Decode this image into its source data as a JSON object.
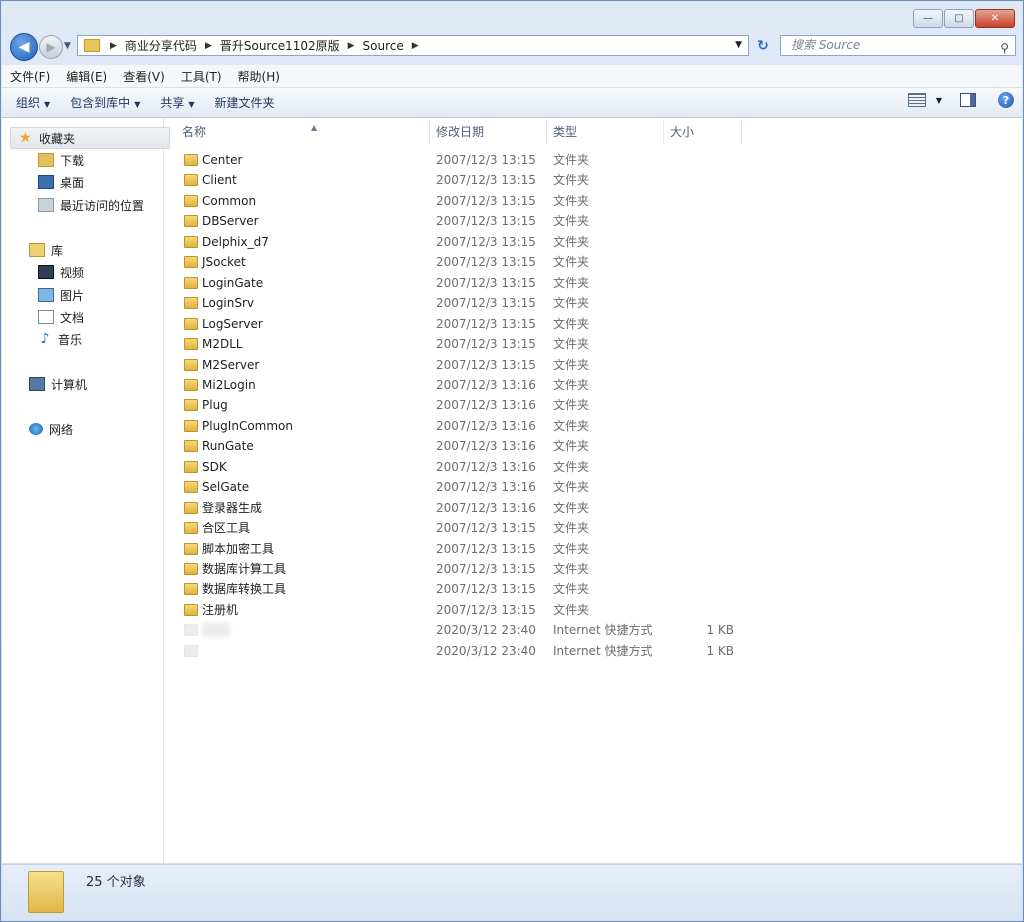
{
  "window": {
    "minimize_symbol": "—",
    "maximize_symbol": "□",
    "close_symbol": "✕"
  },
  "nav": {
    "back_symbol": "◀",
    "forward_symbol": "▶",
    "history_symbol": "▼",
    "refresh_symbol": "↻"
  },
  "address": {
    "crumbs": [
      "商业分享代码",
      "晋升Source1102原版",
      "Source"
    ],
    "sep": "▶",
    "drop": "▼"
  },
  "search": {
    "placeholder": "搜索 Source",
    "icon": "⚲"
  },
  "menu": [
    "文件(F)",
    "编辑(E)",
    "查看(V)",
    "工具(T)",
    "帮助(H)"
  ],
  "toolbar": {
    "organize": "组织",
    "include": "包含到库中",
    "share": "共享",
    "newfolder": "新建文件夹",
    "arrow": "▼",
    "help": "?"
  },
  "navpane": {
    "favorites": "收藏夹",
    "fav_items": [
      "下载",
      "桌面",
      "最近访问的位置"
    ],
    "libraries": "库",
    "lib_items": [
      "视频",
      "图片",
      "文档",
      "音乐"
    ],
    "computer": "计算机",
    "network": "网络"
  },
  "columns": {
    "name": "名称",
    "date": "修改日期",
    "type": "类型",
    "size": "大小",
    "sort_arrow": "▲"
  },
  "files": [
    {
      "name": "Center",
      "date": "2007/12/3 13:15",
      "type": "文件夹",
      "size": ""
    },
    {
      "name": "Client",
      "date": "2007/12/3 13:15",
      "type": "文件夹",
      "size": ""
    },
    {
      "name": "Common",
      "date": "2007/12/3 13:15",
      "type": "文件夹",
      "size": ""
    },
    {
      "name": "DBServer",
      "date": "2007/12/3 13:15",
      "type": "文件夹",
      "size": ""
    },
    {
      "name": "Delphix_d7",
      "date": "2007/12/3 13:15",
      "type": "文件夹",
      "size": ""
    },
    {
      "name": "JSocket",
      "date": "2007/12/3 13:15",
      "type": "文件夹",
      "size": ""
    },
    {
      "name": "LoginGate",
      "date": "2007/12/3 13:15",
      "type": "文件夹",
      "size": ""
    },
    {
      "name": "LoginSrv",
      "date": "2007/12/3 13:15",
      "type": "文件夹",
      "size": ""
    },
    {
      "name": "LogServer",
      "date": "2007/12/3 13:15",
      "type": "文件夹",
      "size": ""
    },
    {
      "name": "M2DLL",
      "date": "2007/12/3 13:15",
      "type": "文件夹",
      "size": ""
    },
    {
      "name": "M2Server",
      "date": "2007/12/3 13:15",
      "type": "文件夹",
      "size": ""
    },
    {
      "name": "Mi2Login",
      "date": "2007/12/3 13:16",
      "type": "文件夹",
      "size": ""
    },
    {
      "name": "Plug",
      "date": "2007/12/3 13:16",
      "type": "文件夹",
      "size": ""
    },
    {
      "name": "PlugInCommon",
      "date": "2007/12/3 13:16",
      "type": "文件夹",
      "size": ""
    },
    {
      "name": "RunGate",
      "date": "2007/12/3 13:16",
      "type": "文件夹",
      "size": ""
    },
    {
      "name": "SDK",
      "date": "2007/12/3 13:16",
      "type": "文件夹",
      "size": ""
    },
    {
      "name": "SelGate",
      "date": "2007/12/3 13:16",
      "type": "文件夹",
      "size": ""
    },
    {
      "name": "登录器生成",
      "date": "2007/12/3 13:16",
      "type": "文件夹",
      "size": ""
    },
    {
      "name": "合区工具",
      "date": "2007/12/3 13:15",
      "type": "文件夹",
      "size": ""
    },
    {
      "name": "脚本加密工具",
      "date": "2007/12/3 13:15",
      "type": "文件夹",
      "size": ""
    },
    {
      "name": "数据库计算工具",
      "date": "2007/12/3 13:15",
      "type": "文件夹",
      "size": ""
    },
    {
      "name": "数据库转换工具",
      "date": "2007/12/3 13:15",
      "type": "文件夹",
      "size": ""
    },
    {
      "name": "注册机",
      "date": "2007/12/3 13:15",
      "type": "文件夹",
      "size": ""
    },
    {
      "name": "▒▒▒",
      "date": "2020/3/12 23:40",
      "type": "Internet 快捷方式",
      "size": "1 KB",
      "blur": true
    },
    {
      "name": "",
      "date": "2020/3/12 23:40",
      "type": "Internet 快捷方式",
      "size": "1 KB",
      "blur": true
    }
  ],
  "status": {
    "count": "25 个对象"
  }
}
